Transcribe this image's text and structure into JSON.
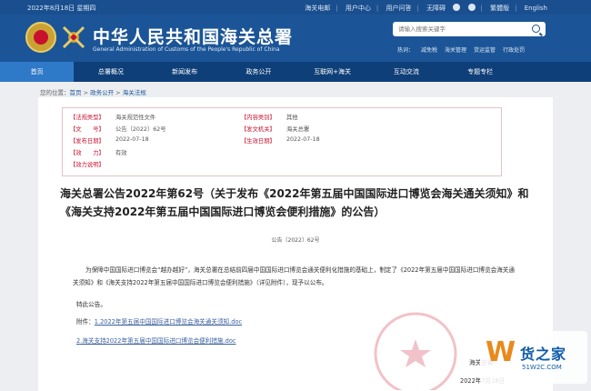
{
  "topbar": {
    "date": "2022年8月18日 星期四",
    "links": [
      "海关电邮",
      "用户中心",
      "用户问答",
      "无障碍",
      "繁體版",
      "English"
    ]
  },
  "header": {
    "title": "中华人民共和国海关总署",
    "subtitle": "General Administration of Customs of the People's Republic of China",
    "search_placeholder": "请输入搜索关键字",
    "hot_label": "热词：",
    "hot_words": [
      "减免税",
      "海关管理",
      "货运监管",
      "行政处罚"
    ]
  },
  "nav": [
    "首页",
    "总署概况",
    "新闻发布",
    "政务公开",
    "互联网+海关",
    "互动交流",
    "专题专栏"
  ],
  "breadcrumb": {
    "prefix": "您的位置：",
    "items": [
      "首页",
      "政务公开",
      "海关法规"
    ]
  },
  "meta": {
    "category_label": "【法规类型】",
    "category": "海关规范性文件",
    "content_type_label": "【内容类别】",
    "content_type": "其他",
    "doc_no_label": "【文　　号】",
    "doc_no": "公告〔2022〕62号",
    "issuer_label": "【发文机关】",
    "issuer": "海关总署",
    "publish_date_label": "【发布日期】",
    "publish_date": "2022-07-18",
    "effective_date_label": "【生效日期】",
    "effective_date": "2022-07-18",
    "validity_label": "【效　　力】",
    "validity": "有效",
    "validity_note_label": "【效力说明】"
  },
  "article": {
    "title": "海关总署公告2022年第62号（关于发布《2022年第五届中国国际进口博览会海关通关须知》和《海关支持2022年第五届中国国际进口博览会便利措施》的公告）",
    "doc_no": "公告〔2022〕62号",
    "para": "为保障中国国际进口博览会“越办越好”，海关总署在总结前四届中国国际进口博览会通关便利化措施的基础上，制定了《2022年第五届中国国际进口博览会海关通关须知》和《海关支持2022年第五届中国国际进口博览会便利措施》（详见附件），现予以公布。",
    "note": "特此公告。",
    "attachment_label": "附件：",
    "attachment1": "1.2022年第五届中国国际进口博览会海关通关须知.doc",
    "attachment2": "2.海关支持2022年第五届中国国际进口博览会便利措施.doc",
    "signer": "海关总署",
    "date": "2022年7月18日"
  },
  "watermark": {
    "logo_letter": "W",
    "brand": "货之家",
    "url": "51W2C.COM"
  },
  "colors": {
    "topbar": "#1a4f8f",
    "header": "#1b5597",
    "nav": "#0f3f78",
    "nav_active": "#2f79c9",
    "label_red": "#c8102e"
  }
}
